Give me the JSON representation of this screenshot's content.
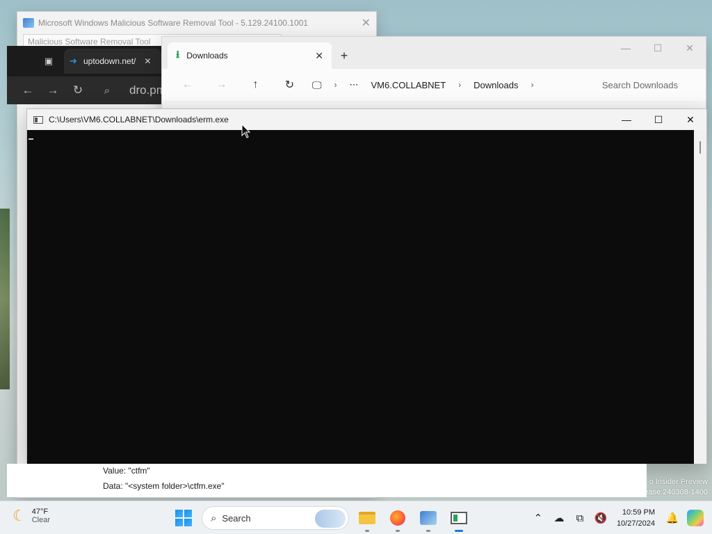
{
  "msrt_window": {
    "title": "Microsoft Windows Malicious Software Removal Tool - 5.129.24100.1001",
    "inner_tab": "Malicious Software Removal Tool"
  },
  "browser": {
    "tab_title": "uptodown.net/",
    "url_text": "dro.pm"
  },
  "explorer": {
    "tab_title": "Downloads",
    "breadcrumb": [
      "VM6.COLLABNET",
      "Downloads"
    ],
    "search_placeholder": "Search Downloads"
  },
  "console": {
    "title": "C:\\Users\\VM6.COLLABNET\\Downloads\\erm.exe",
    "background": "#0c0c0c"
  },
  "info": {
    "value_line": "Value: \"ctfm\"",
    "data_line": "Data: \"<system folder>\\ctfm.exe\""
  },
  "watermark": {
    "line1": "o Insider Preview",
    "line2": "ease.240308-1400"
  },
  "taskbar": {
    "weather_temp": "47°F",
    "weather_cond": "Clear",
    "search_label": "Search",
    "time": "10:59 PM",
    "date": "10/27/2024",
    "accent": "#1d76d2"
  }
}
